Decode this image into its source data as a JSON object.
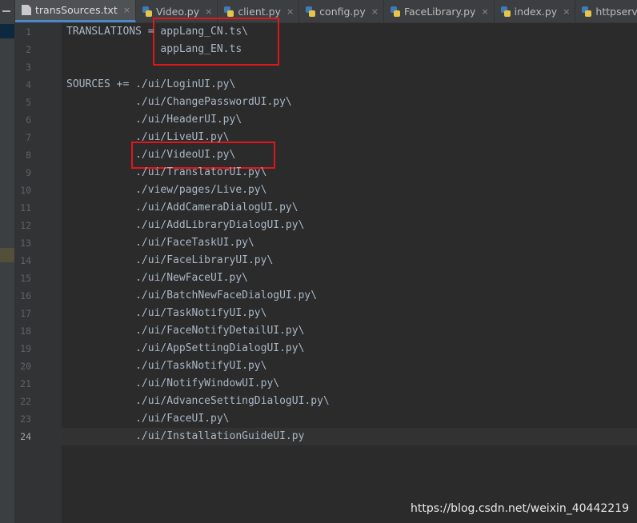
{
  "tabs": [
    {
      "label": "transSources.txt",
      "icon": "text-file-icon",
      "active": true,
      "closable": true
    },
    {
      "label": "Video.py",
      "icon": "python-file-icon",
      "active": false,
      "closable": true
    },
    {
      "label": "client.py",
      "icon": "python-file-icon",
      "active": false,
      "closable": true
    },
    {
      "label": "config.py",
      "icon": "python-file-icon",
      "active": false,
      "closable": true
    },
    {
      "label": "FaceLibrary.py",
      "icon": "python-file-icon",
      "active": false,
      "closable": true
    },
    {
      "label": "index.py",
      "icon": "python-file-icon",
      "active": false,
      "closable": true
    },
    {
      "label": "httpserver.py",
      "icon": "python-file-icon",
      "active": false,
      "closable": false
    }
  ],
  "close_glyph": "×",
  "editor": {
    "current_line": 24,
    "lines": [
      "TRANSLATIONS = appLang_CN.ts\\",
      "               appLang_EN.ts",
      "",
      "SOURCES += ./ui/LoginUI.py\\",
      "           ./ui/ChangePasswordUI.py\\",
      "           ./ui/HeaderUI.py\\",
      "           ./ui/LiveUI.py\\",
      "           ./ui/VideoUI.py\\",
      "           ./ui/TranslatorUI.py\\",
      "           ./view/pages/Live.py\\",
      "           ./ui/AddCameraDialogUI.py\\",
      "           ./ui/AddLibraryDialogUI.py\\",
      "           ./ui/FaceTaskUI.py\\",
      "           ./ui/FaceLibraryUI.py\\",
      "           ./ui/NewFaceUI.py\\",
      "           ./ui/BatchNewFaceDialogUI.py\\",
      "           ./ui/TaskNotifyUI.py\\",
      "           ./ui/FaceNotifyDetailUI.py\\",
      "           ./ui/AppSettingDialogUI.py\\",
      "           ./ui/TaskNotifyUI.py\\",
      "           ./ui/NotifyWindowUI.py\\",
      "           ./ui/AdvanceSettingDialogUI.py\\",
      "           ./ui/FaceUI.py\\",
      "           ./ui/InstallationGuideUI.py"
    ]
  },
  "watermark": "https://blog.csdn.net/weixin_40442219",
  "colors": {
    "highlight_box": "#e0161b",
    "editor_bg": "#2b2b2b",
    "code_text": "#a9b7c6"
  }
}
